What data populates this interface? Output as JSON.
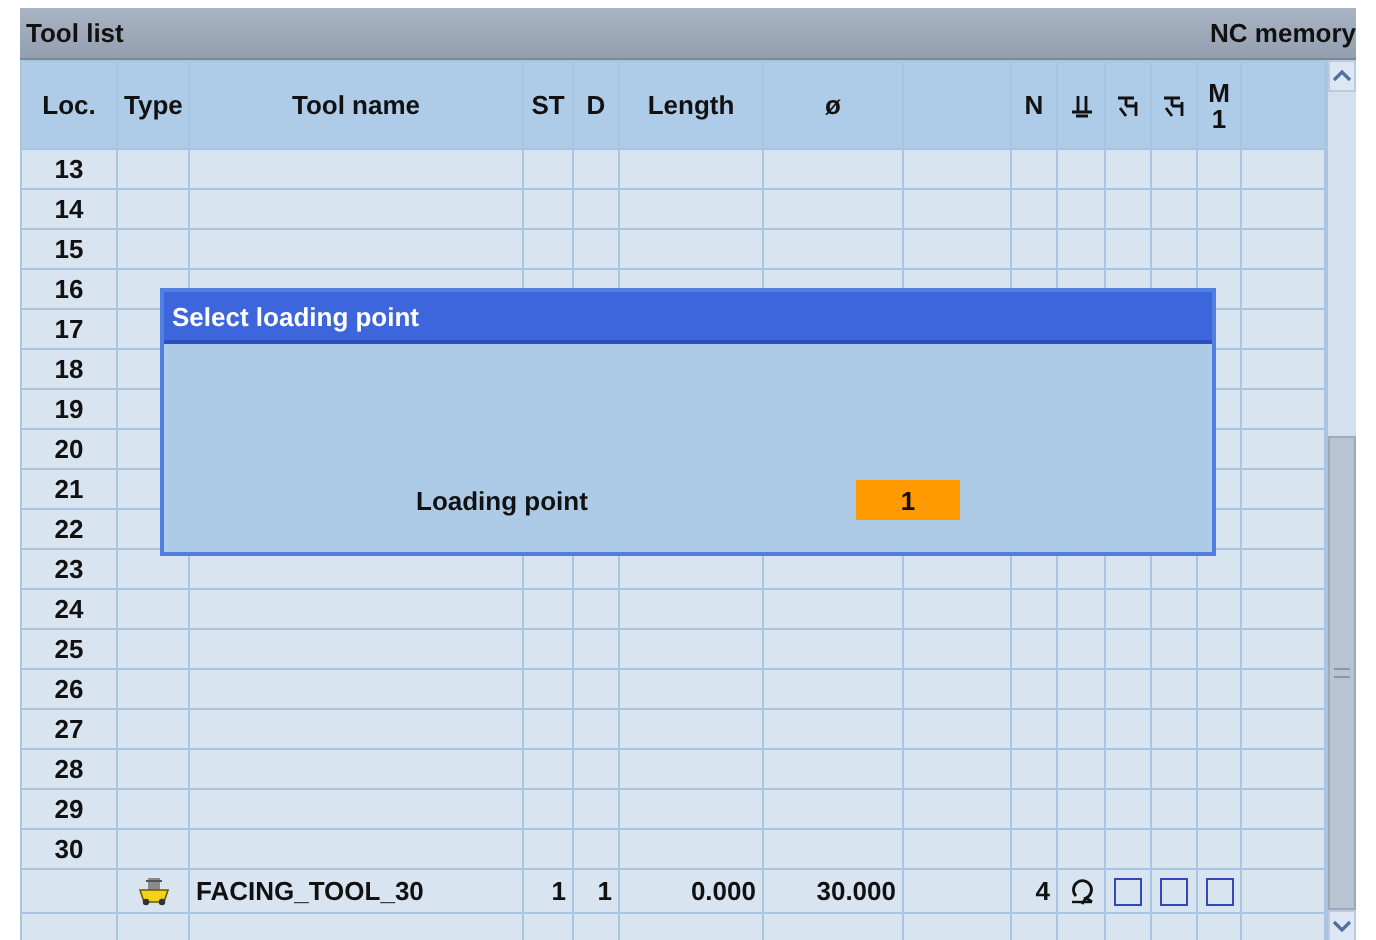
{
  "window": {
    "title": "Tool list",
    "location": "NC memory"
  },
  "table": {
    "columns": [
      {
        "kind": "text",
        "label": "Loc."
      },
      {
        "kind": "text",
        "label": "Type"
      },
      {
        "kind": "text",
        "label": "Tool name"
      },
      {
        "kind": "text",
        "label": "ST"
      },
      {
        "kind": "text",
        "label": "D"
      },
      {
        "kind": "text",
        "label": "Length"
      },
      {
        "kind": "text",
        "label": "ø"
      },
      {
        "kind": "blank"
      },
      {
        "kind": "text",
        "label": "N"
      },
      {
        "kind": "icon"
      },
      {
        "kind": "icon"
      },
      {
        "kind": "icon"
      },
      {
        "kind": "text",
        "label": "M 1"
      },
      {
        "kind": "blank"
      }
    ],
    "locations": [
      "13",
      "14",
      "15",
      "16",
      "17",
      "18",
      "19",
      "20",
      "21",
      "22",
      "23",
      "24",
      "25",
      "26",
      "27",
      "28",
      "29",
      "30"
    ],
    "tool_row": {
      "name": "FACING_TOOL_30",
      "st": "1",
      "d": "1",
      "length": "0.000",
      "diameter": "30.000",
      "n": "4",
      "flags": [
        {
          "checked": false
        },
        {
          "checked": false
        },
        {
          "checked": false
        }
      ]
    }
  },
  "dialog": {
    "title": "Select loading point",
    "label": "Loading point",
    "value": "1"
  }
}
